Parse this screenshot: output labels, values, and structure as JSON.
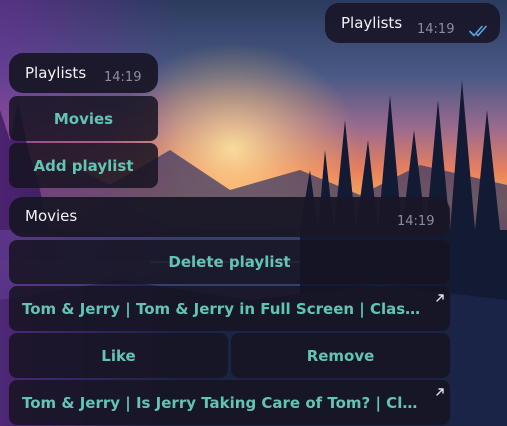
{
  "chat": {
    "outgoing": {
      "text": "Playlists",
      "time": "14:19",
      "status_icon": "double-check-icon"
    },
    "playlists_message": {
      "text": "Playlists",
      "time": "14:19",
      "buttons": [
        "Movies",
        "Add playlist"
      ]
    },
    "movies_message": {
      "text": "Movies",
      "time": "14:19",
      "buttons": {
        "delete": "Delete playlist",
        "video1": "Tom & Jerry | Tom & Jerry in Full Screen | Classic Cartoon Compilation",
        "like": "Like",
        "remove": "Remove",
        "video2": "Tom & Jerry | Is Jerry Taking Care of Tom? | Classic Cartoon Compilation"
      }
    }
  },
  "colors": {
    "bubble": "#181626",
    "button_text": "#62c5b4",
    "read_checks": "#5aa6e0",
    "time": "#8a8e9e"
  }
}
